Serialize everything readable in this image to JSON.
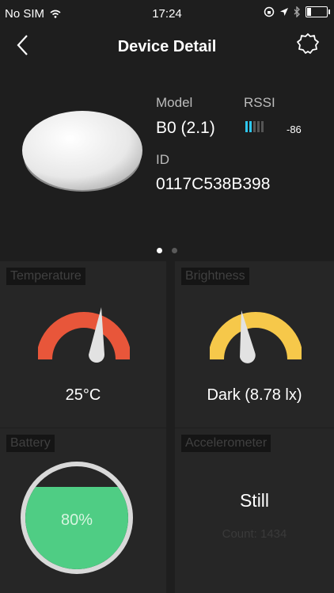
{
  "status_bar": {
    "carrier": "No SIM",
    "time": "17:24"
  },
  "nav": {
    "title": "Device Detail"
  },
  "device": {
    "model_label": "Model",
    "model_value": "B0 (2.1)",
    "rssi_label": "RSSI",
    "rssi_value": "-86",
    "rssi_level": 0.4,
    "id_label": "ID",
    "id_value": "0117C538B398"
  },
  "pager": {
    "pages": 2,
    "active": 0
  },
  "tiles": {
    "temperature": {
      "label": "Temperature",
      "value": "25°C",
      "color": "#e8563a"
    },
    "brightness": {
      "label": "Brightness",
      "value": "Dark (8.78 lx)",
      "color": "#f6c84a"
    },
    "battery": {
      "label": "Battery",
      "value": "80%",
      "level": 0.8,
      "color": "#4fcd84"
    },
    "accelerometer": {
      "label": "Accelerometer",
      "value": "Still",
      "count": "Count: 1434"
    }
  }
}
